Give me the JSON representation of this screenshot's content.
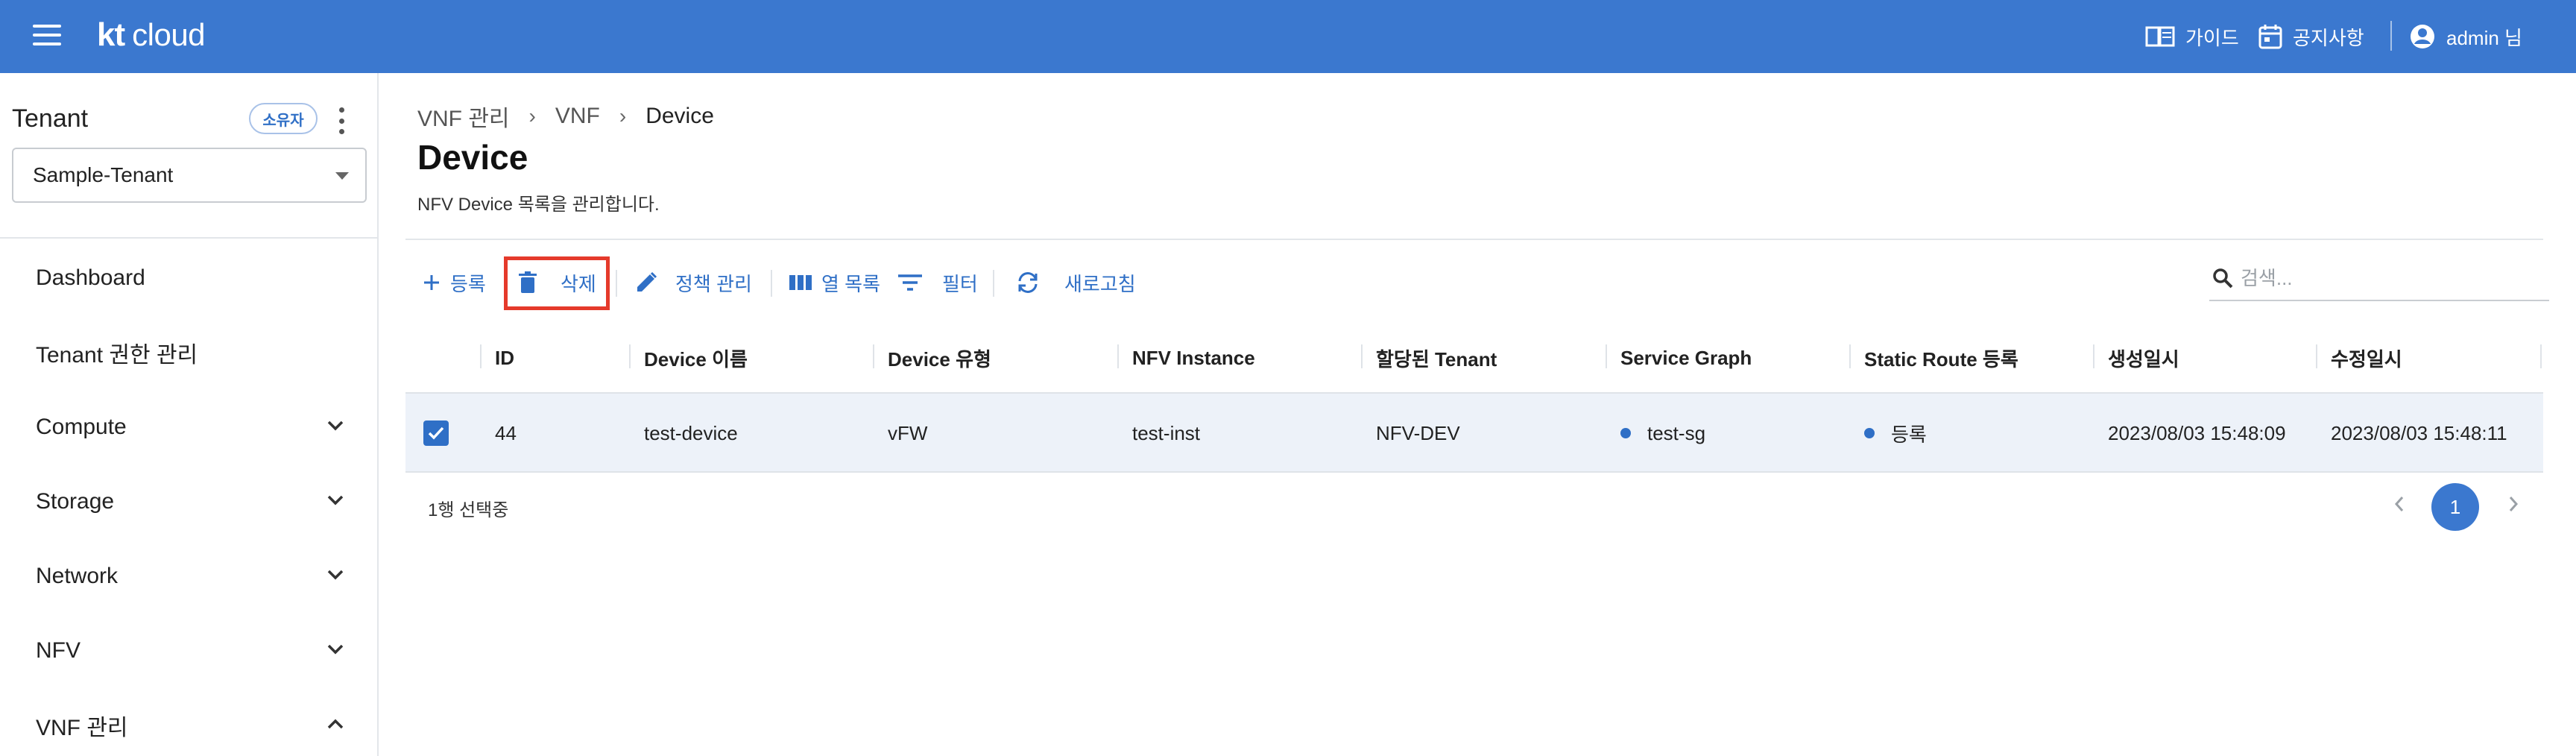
{
  "header": {
    "logo_kt": "kt",
    "logo_cloud": "cloud",
    "guide_label": "가이드",
    "notice_label": "공지사항",
    "user_label": "admin 님",
    "bg_color": "#3b78cf"
  },
  "sidebar": {
    "tenant_title": "Tenant",
    "owner_badge": "소유자",
    "tenant_selected": "Sample-Tenant",
    "items": [
      {
        "label": "Dashboard",
        "expandable": false
      },
      {
        "label": "Tenant 권한 관리",
        "expandable": false
      },
      {
        "label": "Compute",
        "expandable": true,
        "expanded": false
      },
      {
        "label": "Storage",
        "expandable": true,
        "expanded": false
      },
      {
        "label": "Network",
        "expandable": true,
        "expanded": false
      },
      {
        "label": "NFV",
        "expandable": true,
        "expanded": false
      },
      {
        "label": "VNF 관리",
        "expandable": true,
        "expanded": true
      }
    ]
  },
  "breadcrumb": [
    "VNF 관리",
    "VNF",
    "Device"
  ],
  "page": {
    "title": "Device",
    "description": "NFV Device 목록을 관리합니다."
  },
  "toolbar": {
    "add_label": "등록",
    "delete_label": "삭제",
    "policy_label": "정책 관리",
    "columns_label": "열 목록",
    "filter_label": "필터",
    "refresh_label": "새로고침",
    "accent_color": "#2f6fc6",
    "highlight_color": "#e53a2b"
  },
  "search": {
    "placeholder": "검색..."
  },
  "table": {
    "columns": [
      "ID",
      "Device 이름",
      "Device 유형",
      "NFV Instance",
      "할당된 Tenant",
      "Service Graph",
      "Static Route 등록",
      "생성일시",
      "수정일시"
    ],
    "rows": [
      {
        "selected": true,
        "id": "44",
        "device_name": "test-device",
        "device_type": "vFW",
        "nfv_instance": "test-inst",
        "tenant": "NFV-DEV",
        "service_graph": "test-sg",
        "static_route": "등록",
        "created": "2023/08/03 15:48:09",
        "modified": "2023/08/03 15:48:11"
      }
    ]
  },
  "footer": {
    "selected_text": "1행 선택중",
    "current_page": "1"
  }
}
